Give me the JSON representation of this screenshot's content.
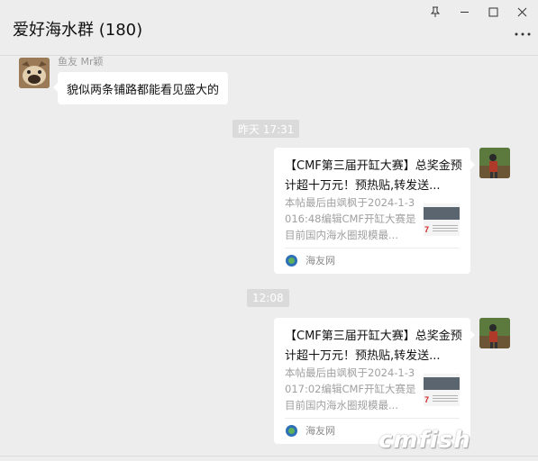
{
  "window": {
    "title": "爱好海水群 (180)",
    "controls": [
      "pin-icon",
      "minimize-icon",
      "maximize-icon",
      "close-icon"
    ],
    "more_icon": "more-dots-icon"
  },
  "messages": [
    {
      "type": "text",
      "sender": "鱼友 Mr颖",
      "avatar": "dog-avatar",
      "text": "貌似两条铺路都能看见盛大的"
    },
    {
      "type": "time",
      "text": "昨天 17:31"
    },
    {
      "type": "link",
      "from_self": true,
      "title": "【CMF第三届开缸大赛】总奖金预计超十万元！预热贴,转发送...",
      "desc": "本帖最后由飒枫于2024-1-3016:48编辑CMF开缸大赛是目前国内海水圈规模最...",
      "source": "海友网"
    },
    {
      "type": "time",
      "text": "12:08"
    },
    {
      "type": "link",
      "from_self": true,
      "title": "【CMF第三届开缸大赛】总奖金预计超十万元！预热贴,转发送...",
      "desc": "本帖最后由飒枫于2024-1-3017:02编辑CMF开缸大赛是目前国内海水圈规模最...",
      "source": "海友网"
    }
  ],
  "watermark": "cmfish",
  "colors": {
    "background": "#ededed",
    "bubble": "#ffffff",
    "time_pill": "#dadada",
    "muted_text": "#a0a0a0"
  }
}
